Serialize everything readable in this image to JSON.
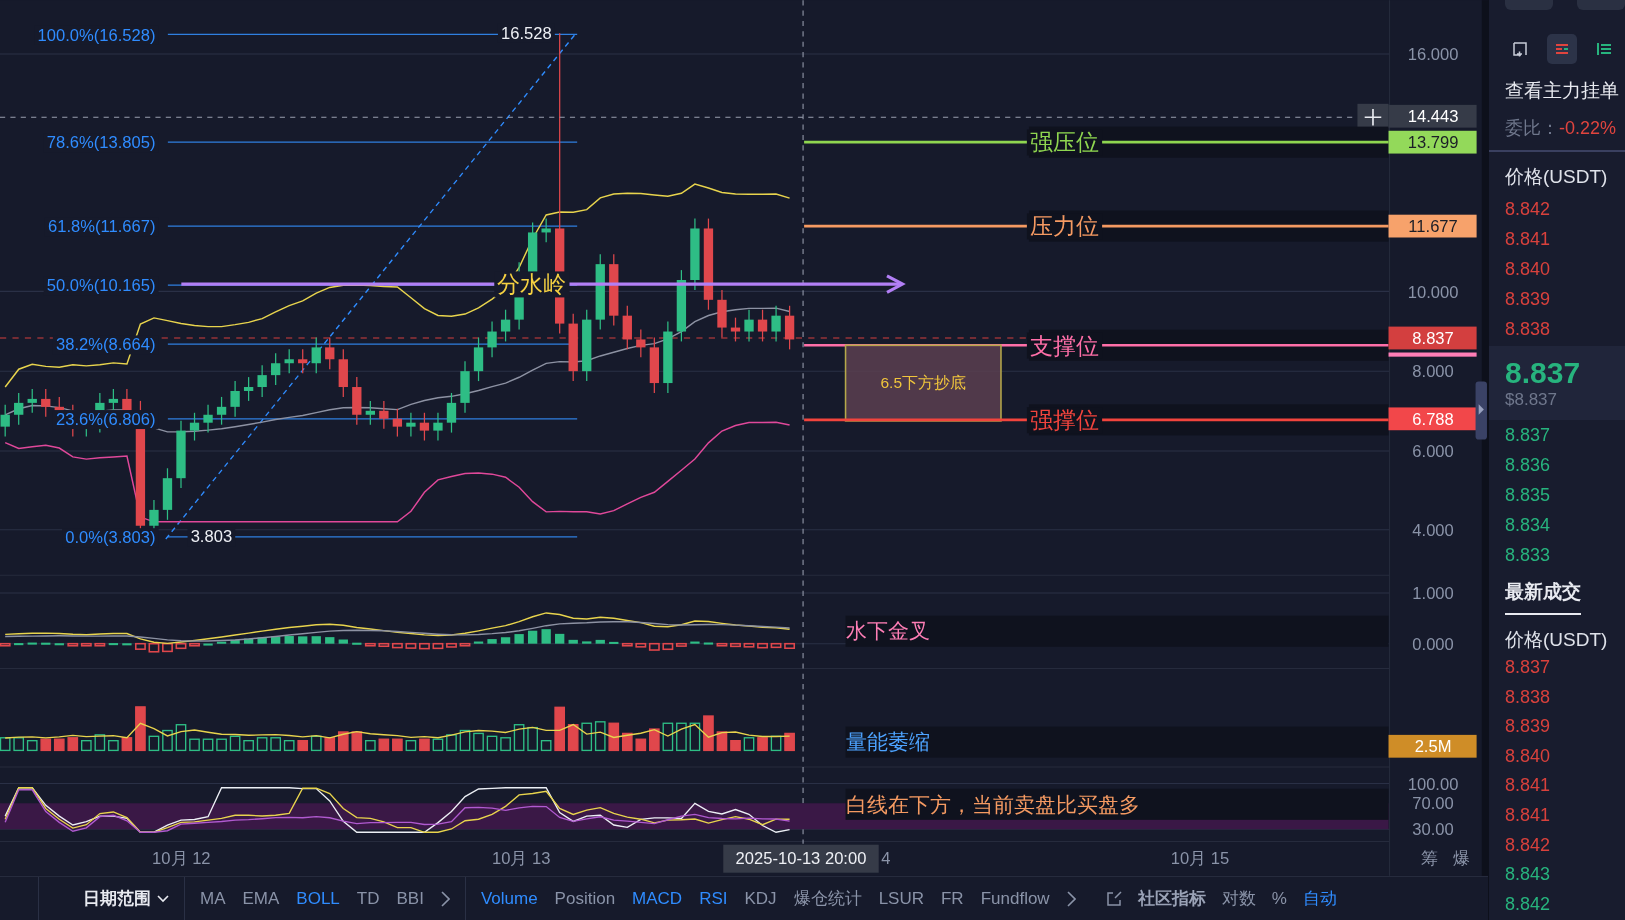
{
  "chart": {
    "fib_levels": [
      {
        "label": "100.0%(16.528)"
      },
      {
        "label": "78.6%(13.805)"
      },
      {
        "label": "61.8%(11.667)"
      },
      {
        "label": "50.0%(10.165)"
      },
      {
        "label": "38.2%(8.664)"
      },
      {
        "label": "23.6%(6.806)"
      },
      {
        "label": "0.0%(3.803)"
      }
    ],
    "price_marks": [
      {
        "label": "16.528"
      },
      {
        "label": "3.803"
      }
    ],
    "annotations": [
      {
        "kind": "level",
        "text": "强压位",
        "color": "#8fd650"
      },
      {
        "kind": "level",
        "text": "压力位",
        "color": "#f59a62"
      },
      {
        "kind": "arrow",
        "text": "分水岭",
        "color": "#f5d142"
      },
      {
        "kind": "level",
        "text": "支撑位",
        "color": "#ff6fa8"
      },
      {
        "kind": "box",
        "text": "6.5下方抄底",
        "color": "#f0c53c"
      },
      {
        "kind": "level",
        "text": "强撑位",
        "color": "#f2443d"
      },
      {
        "kind": "note",
        "text": "水下金叉",
        "color": "#ff7eb6"
      },
      {
        "kind": "note",
        "text": "量能萎缩",
        "color": "#4da3ff"
      },
      {
        "kind": "note",
        "text": "白线在下方，当前卖盘比买盘多",
        "color": "#f59a62"
      }
    ],
    "price_axis": [
      "16.000",
      "10.000",
      "8.000",
      "6.000",
      "4.000"
    ],
    "price_tags": [
      {
        "text": "14.443",
        "color": "#363b48"
      },
      {
        "text": "13.799",
        "color": "#93d95a"
      },
      {
        "text": "11.677",
        "color": "#f7a26b"
      },
      {
        "text": "8.837",
        "color": "#d33f3f"
      },
      {
        "text": "6.788",
        "color": "#f2474a"
      }
    ],
    "macd_axis": [
      "1.000",
      "0.000"
    ],
    "volume_tag": {
      "text": "2.5M",
      "color": "#cf8d27"
    },
    "rsi_axis": [
      "100.00",
      "70.00",
      "30.00"
    ],
    "time_axis": {
      "labels": [
        "10月 12",
        "10月 13",
        "4",
        "10月 15"
      ],
      "crosshair_label": "2025-10-13 20:00",
      "buttons": [
        "筹",
        "爆"
      ]
    }
  },
  "toolbar": {
    "date_range": "日期范围",
    "main_indicators": [
      {
        "label": "MA",
        "selected": false
      },
      {
        "label": "EMA",
        "selected": false
      },
      {
        "label": "BOLL",
        "selected": true
      },
      {
        "label": "TD",
        "selected": false
      },
      {
        "label": "BBI",
        "selected": false
      }
    ],
    "sub_indicators": [
      {
        "label": "Volume",
        "selected": true
      },
      {
        "label": "Position",
        "selected": false
      },
      {
        "label": "MACD",
        "selected": true
      },
      {
        "label": "RSI",
        "selected": true
      },
      {
        "label": "KDJ",
        "selected": false
      },
      {
        "label": "爆仓统计",
        "selected": false
      },
      {
        "label": "LSUR",
        "selected": false
      },
      {
        "label": "FR",
        "selected": false
      },
      {
        "label": "Fundflow",
        "selected": false
      }
    ],
    "community": "社区指标",
    "options": [
      {
        "label": "对数",
        "selected": false
      },
      {
        "label": "%",
        "selected": false
      },
      {
        "label": "自动",
        "selected": true
      }
    ]
  },
  "side": {
    "view_modes": [
      {
        "kind": "both",
        "selected": false
      },
      {
        "kind": "asks",
        "selected": true
      },
      {
        "kind": "bids",
        "selected": false
      }
    ],
    "title": "查看主力挂单",
    "ratio_label": "委比：",
    "ratio_value": "-0.22%",
    "book_header": "价格(USDT)",
    "asks": [
      "8.842",
      "8.841",
      "8.840",
      "8.839",
      "8.838"
    ],
    "last_price": "8.837",
    "last_price_usd": "$8.837",
    "bids": [
      "8.837",
      "8.836",
      "8.835",
      "8.834",
      "8.833"
    ],
    "trades_tab": "最新成交",
    "trades_header": "价格(USDT)",
    "trades": [
      {
        "price": "8.837",
        "kind": "sell"
      },
      {
        "price": "8.838",
        "kind": "sell"
      },
      {
        "price": "8.839",
        "kind": "sell"
      },
      {
        "price": "8.840",
        "kind": "sell"
      },
      {
        "price": "8.841",
        "kind": "sell"
      },
      {
        "price": "8.841",
        "kind": "sell"
      },
      {
        "price": "8.842",
        "kind": "sell"
      },
      {
        "price": "8.843",
        "kind": "buy"
      },
      {
        "price": "8.842",
        "kind": "buy"
      }
    ]
  }
}
